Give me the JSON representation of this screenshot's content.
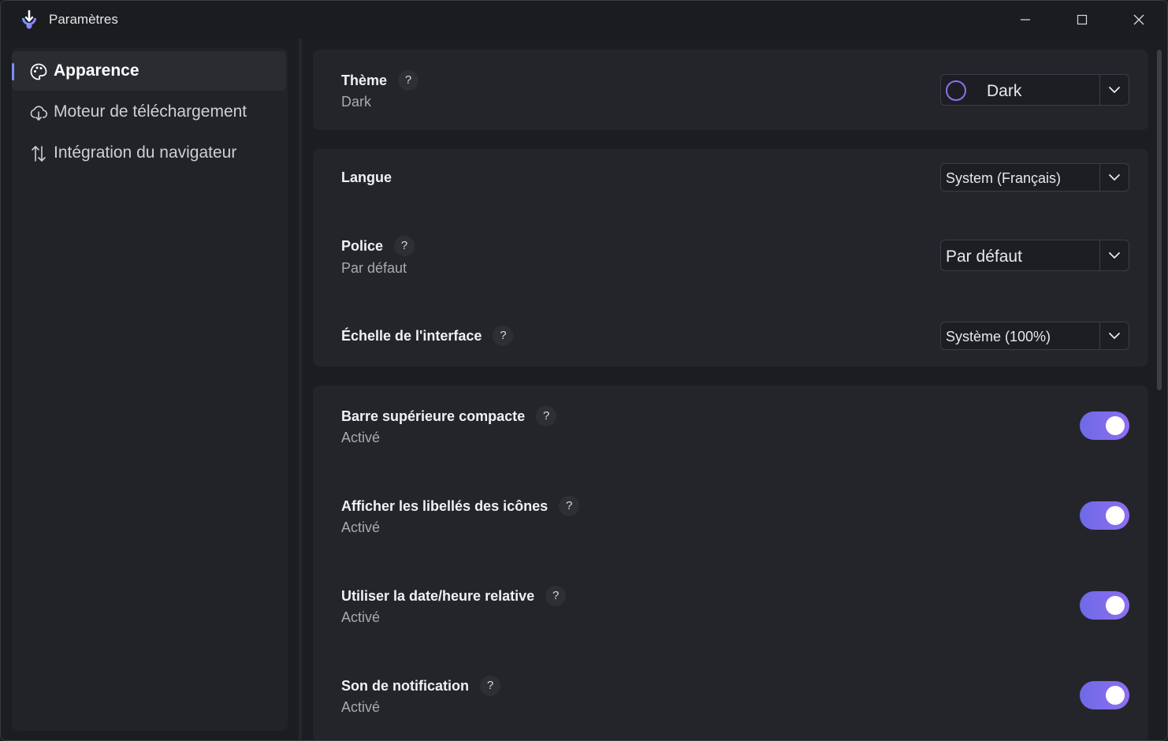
{
  "window": {
    "title": "Paramètres",
    "controls": {
      "minimize": "minimize-icon",
      "maximize": "maximize-icon",
      "close": "close-icon"
    }
  },
  "sidebar": {
    "items": [
      {
        "label": "Apparence",
        "icon": "palette-icon",
        "active": true
      },
      {
        "label": "Moteur de téléchargement",
        "icon": "cloud-download-icon",
        "active": false
      },
      {
        "label": "Intégration du navigateur",
        "icon": "arrows-updown-icon",
        "active": false
      }
    ]
  },
  "settings": {
    "theme": {
      "title": "Thème",
      "help": "?",
      "subtitle": "Dark",
      "value": "Dark"
    },
    "language": {
      "title": "Langue",
      "value": "System (Français)"
    },
    "font": {
      "title": "Police",
      "help": "?",
      "subtitle": "Par défaut",
      "value": "Par défaut"
    },
    "scale": {
      "title": "Échelle de l'interface",
      "help": "?",
      "value": "Système (100%)"
    },
    "compact_topbar": {
      "title": "Barre supérieure compacte",
      "help": "?",
      "subtitle": "Activé",
      "enabled": true
    },
    "icon_labels": {
      "title": "Afficher les libellés des icônes",
      "help": "?",
      "subtitle": "Activé",
      "enabled": true
    },
    "relative_time": {
      "title": "Utiliser la date/heure relative",
      "help": "?",
      "subtitle": "Activé",
      "enabled": true
    },
    "notification_sound": {
      "title": "Son de notification",
      "help": "?",
      "subtitle": "Activé",
      "enabled": true
    }
  },
  "colors": {
    "accent": "#7b8cff",
    "toggle_start": "#6e6ae6",
    "toggle_end": "#8d6ef0",
    "background": "#1c1d21",
    "card": "#24252b"
  }
}
